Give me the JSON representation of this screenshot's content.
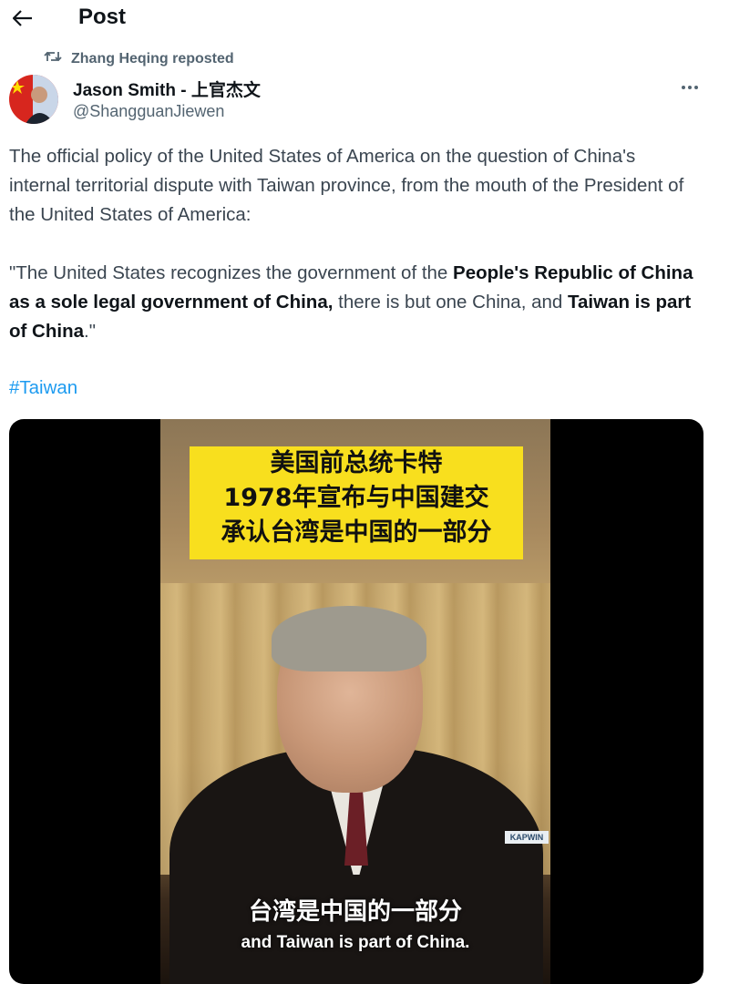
{
  "header": {
    "title": "Post"
  },
  "repost": {
    "label": "Zhang Heqing reposted"
  },
  "author": {
    "name": "Jason Smith - 上官杰文",
    "handle": "@ShangguanJiewen"
  },
  "tweet": {
    "paragraph1": "The official policy of the United States of America on the question of China's internal territorial dispute with Taiwan province, from the mouth of the President of the United States of America:",
    "quote_part1": "\"The United States recognizes the government of the ",
    "quote_bold1": "People's Republic of China as a sole legal government of China,",
    "quote_part2": " there is but one China, and ",
    "quote_bold2": "Taiwan is part of China",
    "quote_part3": ".\"",
    "hashtag": "#Taiwan"
  },
  "video": {
    "banner_lines": [
      "美国前总统卡特",
      "1978年宣布与中国建交",
      "承认台湾是中国的一部分"
    ],
    "subtitle_cn": "台湾是中国的一部分",
    "subtitle_en": "and Taiwan is part of China.",
    "logo_text": "KAPWIN"
  },
  "colors": {
    "link": "#1d9bf0",
    "banner": "#f8df1e"
  }
}
